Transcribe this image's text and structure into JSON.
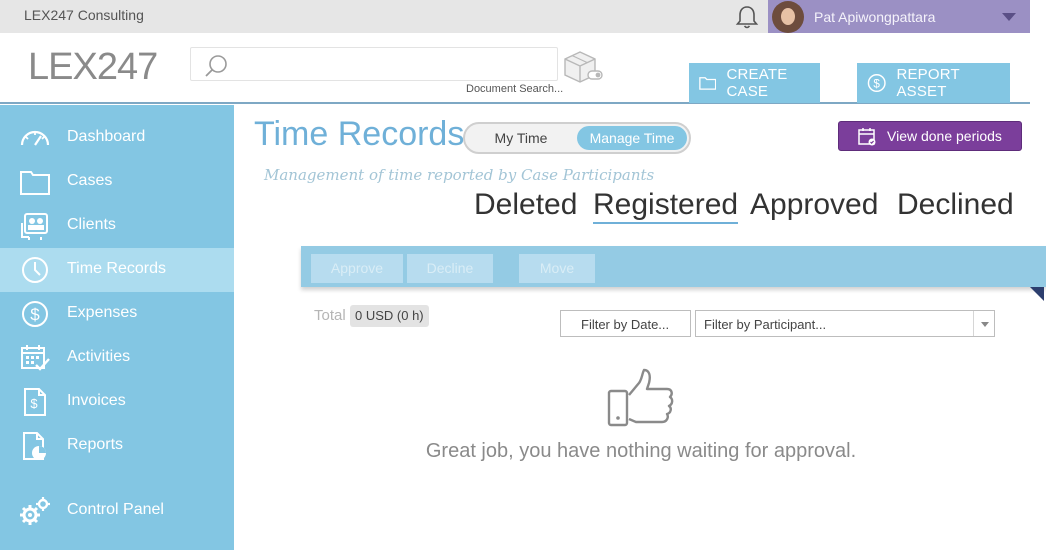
{
  "topbar": {
    "company": "LEX247 Consulting",
    "user_name": "Pat Apiwongpattara"
  },
  "header": {
    "logo": "LEX247",
    "search_placeholder": "",
    "search_caption": "Document Search...",
    "create_case_label": "CREATE CASE",
    "report_asset_label": "REPORT ASSET"
  },
  "sidebar": {
    "items": [
      {
        "label": "Dashboard",
        "icon": "gauge-icon"
      },
      {
        "label": "Cases",
        "icon": "folder-icon"
      },
      {
        "label": "Clients",
        "icon": "clients-icon"
      },
      {
        "label": "Time Records",
        "icon": "clock-icon"
      },
      {
        "label": "Expenses",
        "icon": "dollar-icon"
      },
      {
        "label": "Activities",
        "icon": "calendar-check-icon"
      },
      {
        "label": "Invoices",
        "icon": "invoice-icon"
      },
      {
        "label": "Reports",
        "icon": "report-icon"
      },
      {
        "label": "Control Panel",
        "icon": "gears-icon"
      }
    ],
    "active": "Time Records"
  },
  "main": {
    "title": "Time Records",
    "toggle": {
      "my_time": "My Time",
      "manage_time": "Manage Time",
      "selected": "Manage Time"
    },
    "done_periods_label": "View done periods",
    "subtitle": "Management of time reported by Case Participants",
    "filter_tabs": [
      "Deleted",
      "Registered",
      "Approved",
      "Declined"
    ],
    "selected_tab": "Registered",
    "actions": {
      "approve": "Approve",
      "decline": "Decline",
      "move": "Move"
    },
    "total_label": "Total",
    "total_value": "0 USD (0 h)",
    "filter_date_placeholder": "Filter by Date...",
    "filter_participant_placeholder": "Filter by Participant...",
    "empty_message": "Great job, you have nothing waiting for approval."
  },
  "colors": {
    "sidebar": "#83c6e3",
    "sidebar_active": "#acdcef",
    "accent": "#6fb0d8",
    "purple": "#7b3e9b",
    "user_area": "#9b90c4"
  }
}
